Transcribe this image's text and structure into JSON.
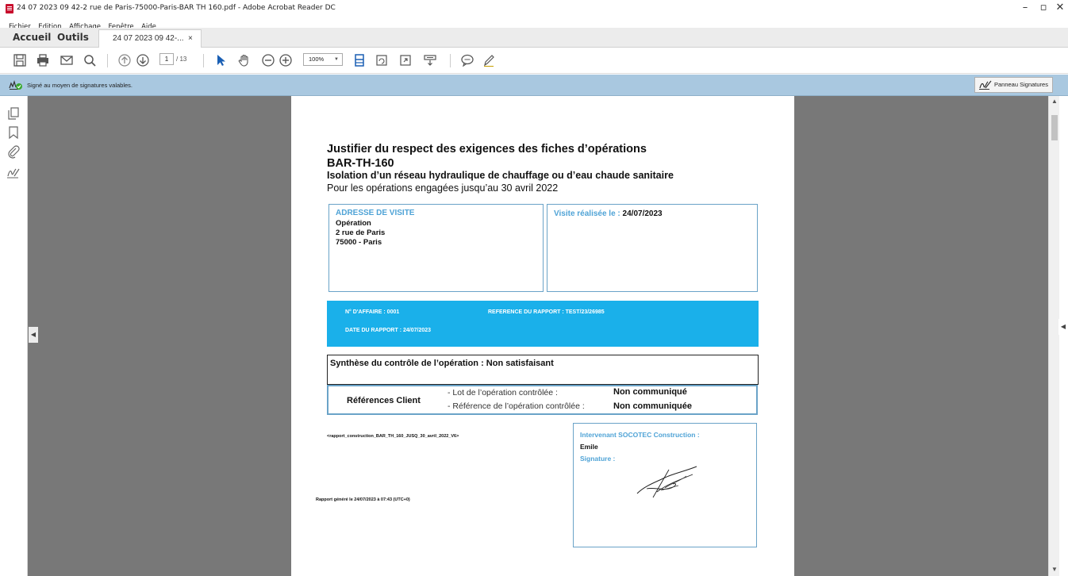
{
  "window": {
    "title": "24 07 2023 09 42-2 rue de Paris-75000-Paris-BAR TH 160.pdf - Adobe Acrobat Reader DC",
    "minimize": "–",
    "maximize": "▫",
    "close": "✕"
  },
  "menu": [
    "Fichier",
    "Edition",
    "Affichage",
    "Fenêtre",
    "Aide"
  ],
  "tabs": {
    "home": "Accueil",
    "tools": "Outils",
    "document": "24 07 2023 09 42-...",
    "close": "×"
  },
  "toolbar": {
    "icons": [
      "save-icon",
      "print-icon",
      "email-icon",
      "search-icon",
      "prev-page-icon",
      "next-page-icon",
      "select-arrow-icon",
      "hand-icon",
      "zoom-out-icon",
      "zoom-in-icon",
      "fit-page-icon",
      "rotate-icon",
      "fullscreen-icon",
      "scroll-mode-icon",
      "comment-icon",
      "pen-icon"
    ],
    "page_current": "1",
    "page_total": "/ 13",
    "zoom": "100%"
  },
  "signature_bar": {
    "message": "Signé au moyen de signatures valables.",
    "panel_button": "Panneau Signatures"
  },
  "left_rail": [
    "pages-icon",
    "bookmark-icon",
    "attachment-icon",
    "signature-icon"
  ],
  "document": {
    "heading1": "Justifier du respect des exigences des fiches d’opérations",
    "heading2": "BAR-TH-160",
    "heading3": "Isolation d’un réseau hydraulique de chauffage ou d’eau chaude sanitaire",
    "heading4": "Pour les opérations engagées jusqu’au 30 avril 2022",
    "address": {
      "label": "ADRESSE DE VISITE",
      "line1": "Opération",
      "line2": "2 rue de Paris",
      "line3": "75000 - Paris"
    },
    "visit": {
      "label": "Visite réalisée le : ",
      "date": "24/07/2023"
    },
    "info": {
      "affaire": "N° D'AFFAIRE : 0001",
      "reference": "REFERENCE DU RAPPORT : TEST/23/26985",
      "date": "DATE DU RAPPORT : 24/07/2023"
    },
    "synthesis": "Synthèse du contrôle de l’opération : Non satisfaisant",
    "client_refs": {
      "label": "Références Client",
      "lot_label": "- Lot de l’opération contrôlée :",
      "lot_value": "Non communiqué",
      "ref_label": "- Référence de l’opération contrôlée :",
      "ref_value": "Non communiquée"
    },
    "template_name": "<rapport_construction_BAR_TH_160_JUSQ_30_avril_2022_V6>",
    "generated": "Rapport généré le 24/07/2023 à 07:43 (UTC+0)",
    "intervenant": {
      "label": "Intervenant SOCOTEC Construction :",
      "name": "Emile",
      "signature_label": "Signature :"
    }
  }
}
